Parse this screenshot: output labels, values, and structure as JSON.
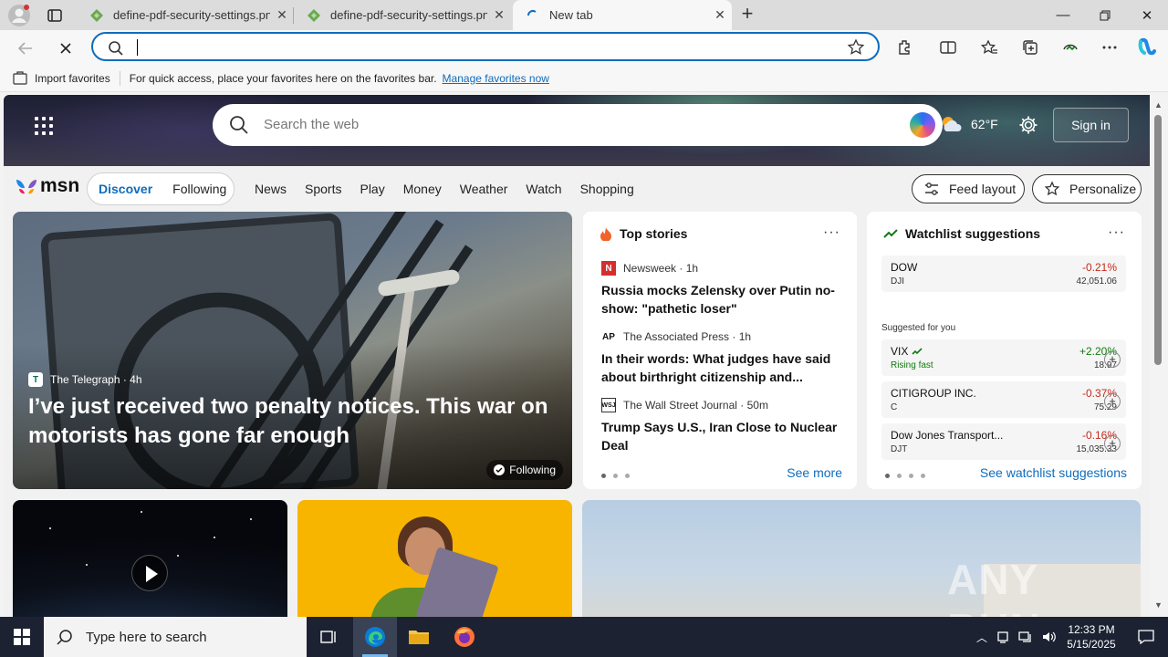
{
  "tabs": [
    {
      "title": "define-pdf-security-settings.png",
      "state": "inactive"
    },
    {
      "title": "define-pdf-security-settings.png",
      "state": "inactive"
    },
    {
      "title": "New tab",
      "state": "active"
    }
  ],
  "address": {
    "value": "",
    "placeholder": ""
  },
  "favorites_bar": {
    "import_label": "Import favorites",
    "hint": "For quick access, place your favorites here on the favorites bar.",
    "manage_link": "Manage favorites now"
  },
  "msn": {
    "search_placeholder": "Search the web",
    "weather_temp": "62°F",
    "sign_in": "Sign in",
    "logo_text": "msn",
    "pill": {
      "discover": "Discover",
      "following": "Following"
    },
    "nav": [
      "News",
      "Sports",
      "Play",
      "Money",
      "Weather",
      "Watch",
      "Shopping"
    ],
    "feed_layout": "Feed layout",
    "personalize": "Personalize"
  },
  "main_story": {
    "source": "The Telegraph",
    "age": "· 4h",
    "headline": "I’ve just received two penalty notices. This war on motorists has gone far enough",
    "follow_chip": "Following"
  },
  "top_stories": {
    "header": "Top stories",
    "items": [
      {
        "source": "Newsweek",
        "age": "· 1h",
        "logo": "N",
        "title": "Russia mocks Zelensky over Putin no-show: \"pathetic loser\""
      },
      {
        "source": "The Associated Press",
        "age": "· 1h",
        "logo": "AP",
        "title": "In their words: What judges have said about birthright citizenship and..."
      },
      {
        "source": "The Wall Street Journal",
        "age": "· 50m",
        "logo": "WSJ",
        "title": "Trump Says U.S., Iran Close to Nuclear Deal"
      }
    ],
    "see_more": "See more"
  },
  "watchlist": {
    "header": "Watchlist suggestions",
    "top": {
      "symbol": "DOW",
      "sub": "DJI",
      "change": "-0.21%",
      "value": "42,051.06"
    },
    "suggested_label": "Suggested for you",
    "items": [
      {
        "symbol": "VIX",
        "sub": "Rising fast",
        "change": "+2.20%",
        "value": "18.97",
        "up": true
      },
      {
        "symbol": "CITIGROUP INC.",
        "sub": "C",
        "change": "-0.37%",
        "value": "75.29",
        "up": false
      },
      {
        "symbol": "Dow Jones Transport...",
        "sub": "DJT",
        "change": "-0.16%",
        "value": "15,035.33",
        "up": false
      }
    ],
    "see_link": "See watchlist suggestions"
  },
  "watermark": "ANY RUN",
  "taskbar": {
    "search_placeholder": "Type here to search",
    "time": "12:33 PM",
    "date": "5/15/2025"
  },
  "colors": {
    "accent": "#0f6cbd",
    "negative": "#c42b1c",
    "positive": "#107c10"
  }
}
